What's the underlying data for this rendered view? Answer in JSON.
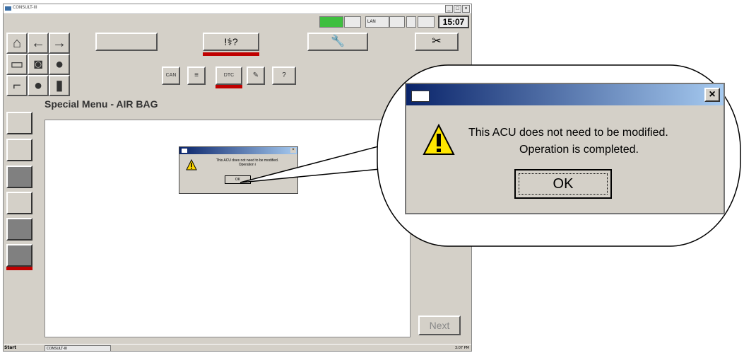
{
  "window": {
    "title": "CONSULT-III",
    "controls": [
      "_",
      "□",
      "×"
    ]
  },
  "status": {
    "lan_label": "LAN",
    "clock": "15:07"
  },
  "main": {
    "menu_title": "Special Menu - AIR BAG",
    "next_label": "Next"
  },
  "dialog": {
    "message_line1": "This ACU does not need to be modified.",
    "message_line2": "Operation is completed.",
    "ok_label": "OK",
    "close_label": "×"
  },
  "small_dialog": {
    "message_line1": "This ACU does not need to be modified.",
    "message_line2": "Operation i",
    "ok_label": "OK"
  },
  "taskbar": {
    "start_label": "Start",
    "task_label": "CONSULT-III",
    "tray_time": "3:07 PM"
  },
  "toolbar": {
    "can_label": "CAN",
    "dtc_label": "DTC"
  },
  "colors": {
    "accent_red": "#c00000",
    "titlebar_dark": "#0a246a",
    "titlebar_light": "#a6caf0",
    "face": "#d4d0c8"
  }
}
